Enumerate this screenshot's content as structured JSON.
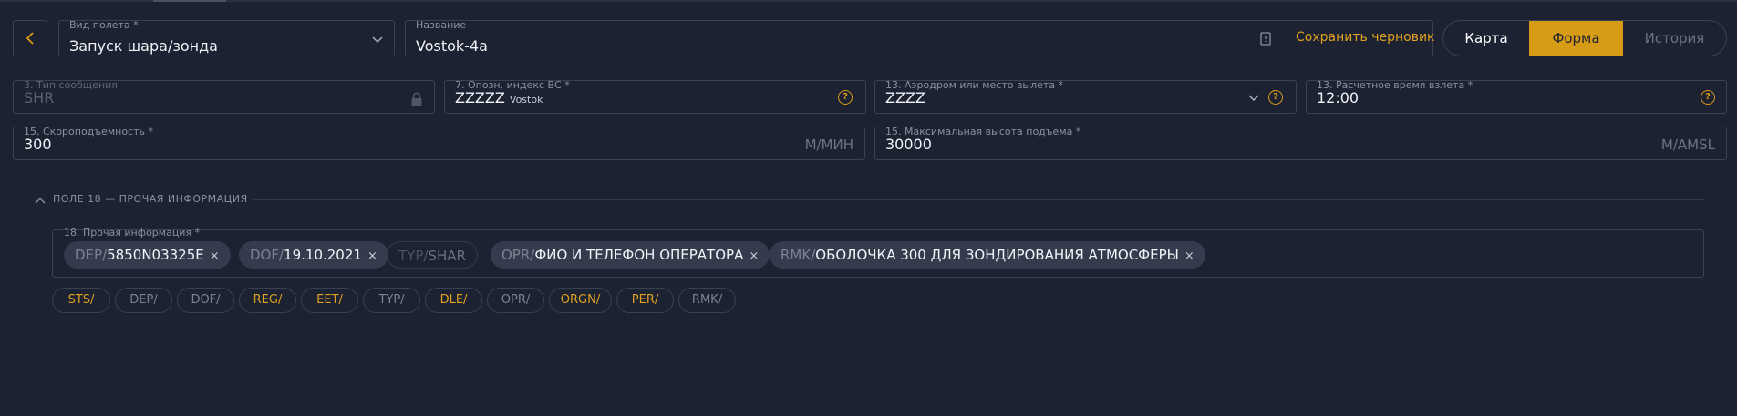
{
  "header": {
    "flight_type": {
      "label": "Вид полета *",
      "value": "Запуск шара/зонда"
    },
    "name": {
      "label": "Название",
      "value": "Vostok-4a"
    },
    "save_draft": "Сохранить черновик",
    "tabs": [
      {
        "label": "Карта",
        "active": false
      },
      {
        "label": "Форма",
        "active": true
      },
      {
        "label": "История",
        "active": false
      }
    ]
  },
  "fields": {
    "msg_type": {
      "label": "3. Тип сообщения",
      "value": "SHR"
    },
    "aircraft_id": {
      "label": "7. Опозн. индекс ВС *",
      "value": "ZZZZZ",
      "sub": "Vostok"
    },
    "departure": {
      "label": "13. Аэродром или место вылета *",
      "value": "ZZZZ"
    },
    "dep_time": {
      "label": "13. Расчетное время взлета *",
      "value": "12:00"
    },
    "climb_rate": {
      "label": "15. Скороподъемность *",
      "value": "300",
      "unit": "М/МИН"
    },
    "max_alt": {
      "label": "15. Максимальная высота подъема *",
      "value": "30000",
      "unit": "M/AMSL"
    }
  },
  "section18": {
    "title": "ПОЛЕ 18 — ПРОЧАЯ ИНФОРМАЦИЯ",
    "field_label": "18. Прочая информация *",
    "chips": [
      {
        "key": "DEP/",
        "value": "5850N03325E",
        "removable": true
      },
      {
        "key": "DOF/",
        "value": "19.10.2021",
        "removable": true
      },
      {
        "key": "TYP/",
        "value": "SHAR",
        "removable": false
      },
      {
        "key": "OPR/",
        "value": "ФИО И ТЕЛЕФОН ОПЕРАТОРА",
        "removable": true
      },
      {
        "key": "RMK/",
        "value": "ОБОЛОЧКА 300 ДЛЯ ЗОНДИРОВАНИЯ АТМОСФЕРЫ",
        "removable": true
      }
    ],
    "remove_symbol": "×",
    "suggestions": [
      {
        "label": "STS/",
        "color": "orange"
      },
      {
        "label": "DEP/",
        "color": "grey"
      },
      {
        "label": "DOF/",
        "color": "grey"
      },
      {
        "label": "REG/",
        "color": "orange"
      },
      {
        "label": "EET/",
        "color": "orange"
      },
      {
        "label": "TYP/",
        "color": "grey"
      },
      {
        "label": "DLE/",
        "color": "orange"
      },
      {
        "label": "OPR/",
        "color": "grey"
      },
      {
        "label": "ORGN/",
        "color": "orange"
      },
      {
        "label": "PER/",
        "color": "orange"
      },
      {
        "label": "RMK/",
        "color": "grey"
      }
    ]
  },
  "colors": {
    "background": "#1c2231",
    "accent": "#d89b16",
    "border": "#3a4152"
  },
  "icons": [
    "chevron-left-icon",
    "chevron-down-icon",
    "document-icon",
    "lock-icon",
    "help-icon",
    "close-icon",
    "chevron-up-icon"
  ]
}
